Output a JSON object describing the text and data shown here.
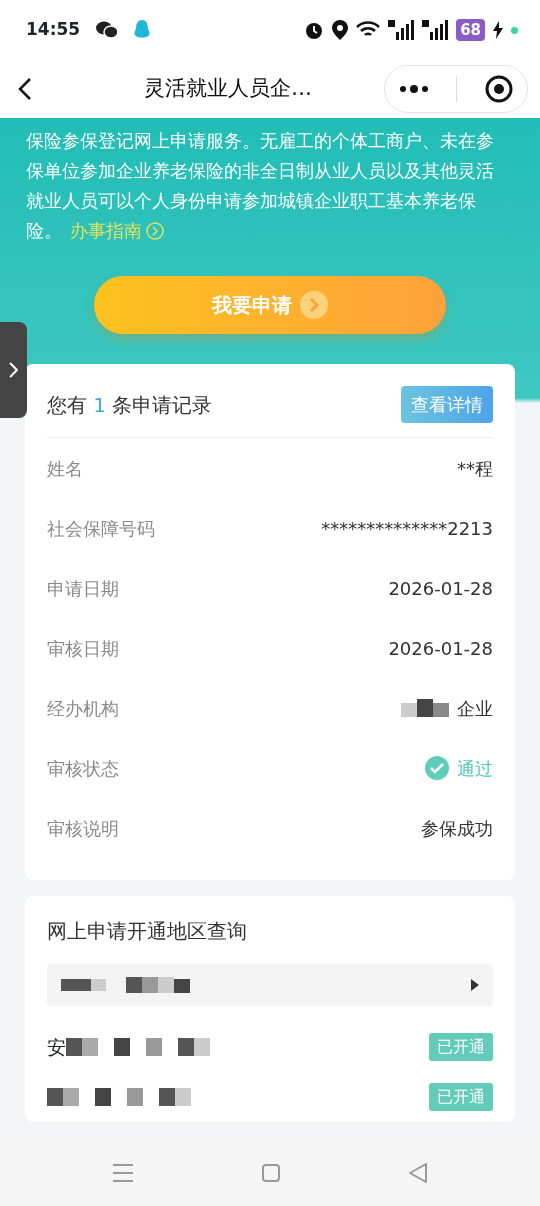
{
  "status_bar": {
    "time": "14:55",
    "battery": "68"
  },
  "header": {
    "title": "灵活就业人员企…"
  },
  "intro": {
    "lines": [
      "保险参保登记网上申请服务。无雇工的个体工商户、未在参",
      "保单位参加企业养老保险的非全日制从业人员以及其他灵活",
      "就业人员可以个人身份申请参加城镇企业职工基本养老保"
    ],
    "last_line": "险。",
    "guide_link": "办事指南"
  },
  "apply_button": {
    "label": "我要申请"
  },
  "record_card": {
    "prefix": "您有",
    "count": "1",
    "suffix": "条申请记录",
    "detail_button": "查看详情",
    "fields": [
      {
        "label": "姓名",
        "value": "**程",
        "kind": "text"
      },
      {
        "label": "社会保障号码",
        "value": "**************2213",
        "kind": "text"
      },
      {
        "label": "申请日期",
        "value": "2026-01-28",
        "kind": "text"
      },
      {
        "label": "审核日期",
        "value": "2026-01-28",
        "kind": "text"
      },
      {
        "label": "经办机构",
        "value": "企业",
        "kind": "redacted"
      },
      {
        "label": "审核状态",
        "value": "通过",
        "kind": "status"
      },
      {
        "label": "审核说明",
        "value": "参保成功",
        "kind": "text"
      }
    ]
  },
  "region_card": {
    "title": "网上申请开通地区查询",
    "regions": [
      {
        "name": "安",
        "badge": "已开通"
      },
      {
        "badge": "已开通"
      }
    ]
  }
}
